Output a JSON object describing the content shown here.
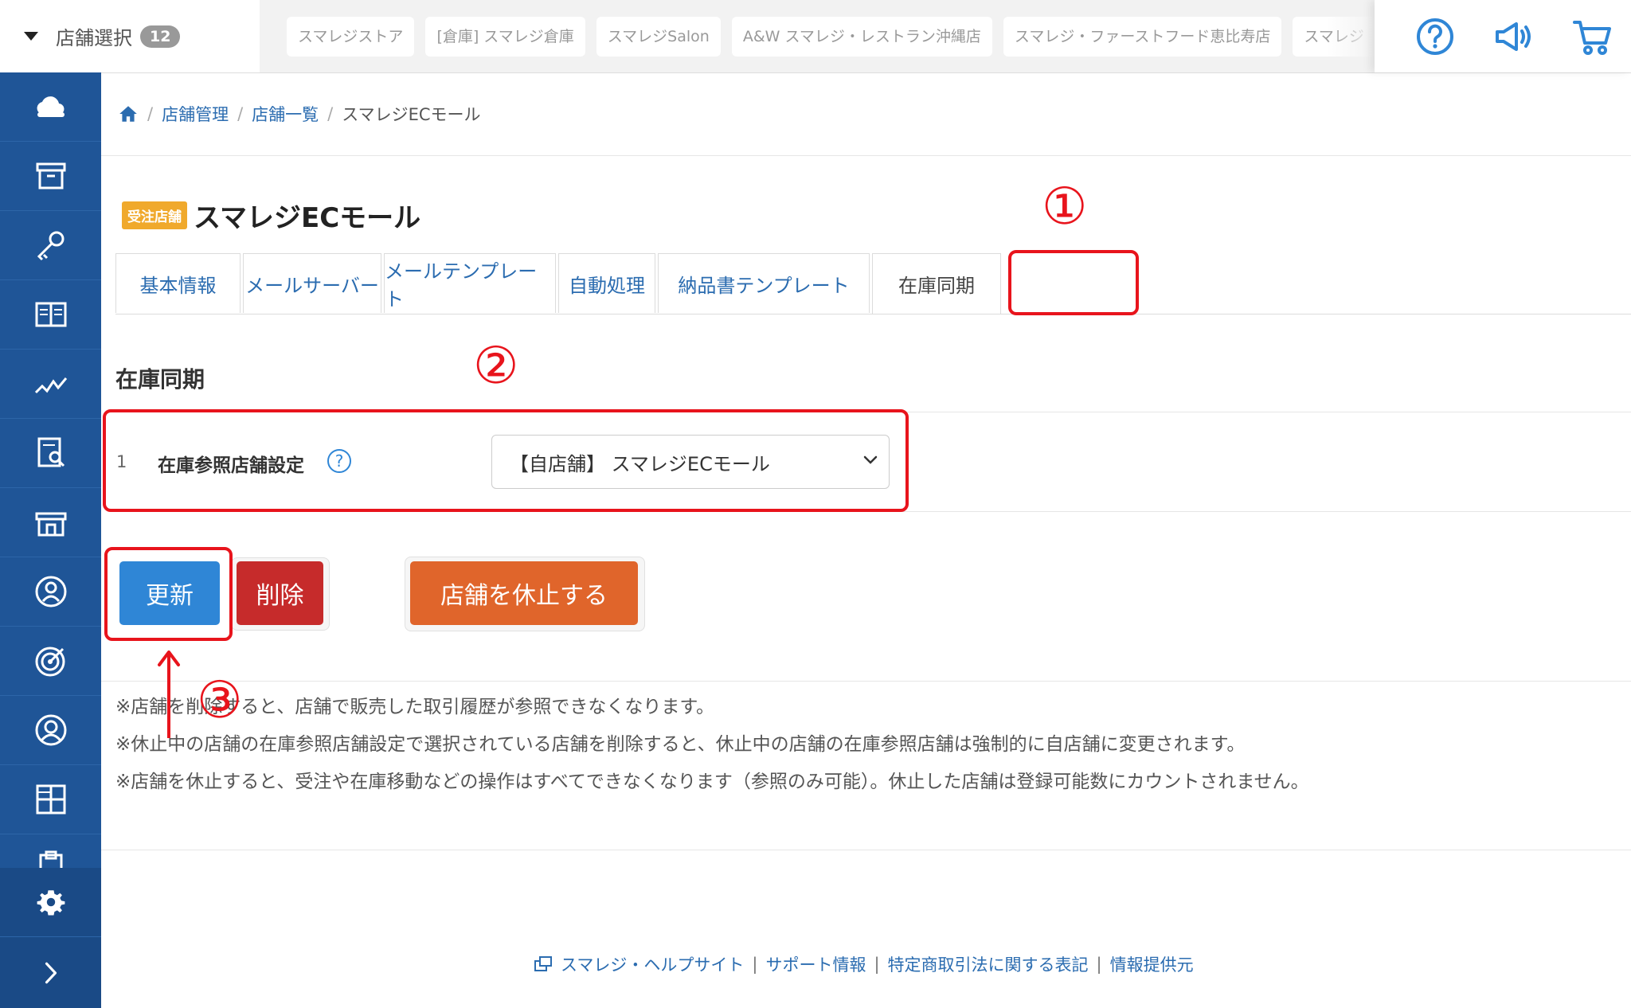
{
  "topbar": {
    "store_select_label": "店舗選択",
    "store_count": "12",
    "store_tabs": [
      "スマレジストア",
      "[倉庫] スマレジ倉庫",
      "スマレジSalon",
      "A&W スマレジ・レストラン沖縄店",
      "スマレジ・ファーストフード恵比寿店",
      "スマレジ"
    ],
    "icons": [
      "help-circle-icon",
      "megaphone-icon",
      "cart-icon"
    ]
  },
  "sidebar": {
    "icons": [
      "cloud-icon",
      "archive-box-icon",
      "key-icon",
      "book-icon",
      "chart-line-icon",
      "report-search-icon",
      "storefront-icon",
      "user-badge-icon",
      "target-icon",
      "user-circle-icon",
      "grid-icon",
      "clipboard-icon",
      "gear-icon",
      "chevron-right-icon"
    ]
  },
  "breadcrumb": {
    "home_icon": "home-icon",
    "items": [
      "店舗管理",
      "店舗一覧"
    ],
    "current": "スマレジECモール"
  },
  "page": {
    "badge": "受注店舗",
    "title": "スマレジECモール"
  },
  "tabs": [
    {
      "label": "基本情報"
    },
    {
      "label": "メールサーバー"
    },
    {
      "label": "メールテンプレート"
    },
    {
      "label": "自動処理"
    },
    {
      "label": "納品書テンプレート"
    },
    {
      "label": "在庫同期",
      "active": true
    }
  ],
  "section": {
    "title": "在庫同期",
    "row_number": "1",
    "row_label": "在庫参照店舗設定",
    "select_value": "【自店舗】 スマレジECモール"
  },
  "buttons": {
    "update": "更新",
    "delete": "削除",
    "suspend": "店舗を休止する"
  },
  "notes": [
    "※店舗を削除すると、店舗で販売した取引履歴が参照できなくなります。",
    "※休止中の店舗の在庫参照店舗設定で選択されている店舗を削除すると、休止中の店舗の在庫参照店舗は強制的に自店舗に変更されます。",
    "※店舗を休止すると、受注や在庫移動などの操作はすべてできなくなります（参照のみ可能）。休止した店舗は登録可能数にカウントされません。"
  ],
  "footer": {
    "links": [
      "スマレジ・ヘルプサイト",
      "サポート情報",
      "特定商取引法に関する表記",
      "情報提供元"
    ]
  },
  "annotations": {
    "step1": "①",
    "step2": "②",
    "step3": "③",
    "color": "#e8141c"
  },
  "colors": {
    "sidebar": "#1f5597",
    "update_button": "#2f86d6",
    "delete_button": "#c62b2b",
    "suspend_button": "#e0652b",
    "link": "#2b6cb0",
    "badge": "#f0a92c"
  }
}
